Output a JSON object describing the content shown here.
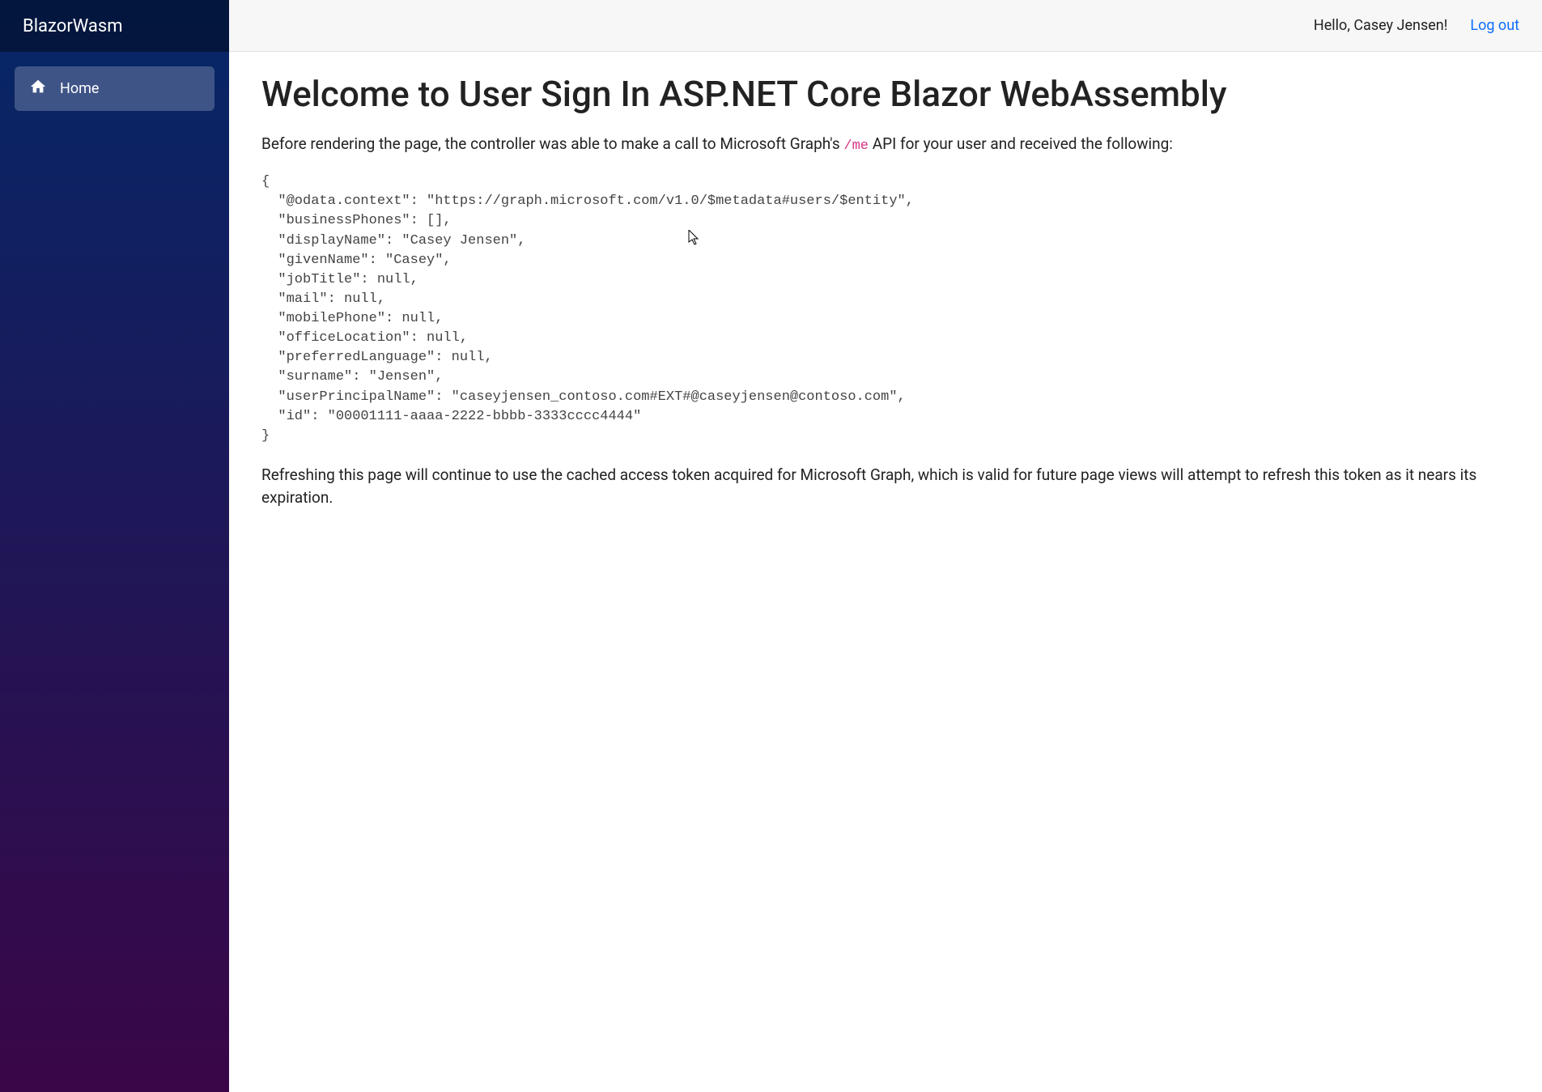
{
  "sidebar": {
    "brand": "BlazorWasm",
    "items": [
      {
        "label": "Home",
        "icon": "home-icon",
        "active": true
      }
    ]
  },
  "topbar": {
    "greeting": "Hello, Casey Jensen!",
    "logout_label": "Log out"
  },
  "main": {
    "title": "Welcome to User Sign In ASP.NET Core Blazor WebAssembly",
    "intro_prefix": "Before rendering the page, the controller was able to make a call to Microsoft Graph's ",
    "intro_code": "/me",
    "intro_suffix": " API for your user and received the following:",
    "json_text": "{\n  \"@odata.context\": \"https://graph.microsoft.com/v1.0/$metadata#users/$entity\",\n  \"businessPhones\": [],\n  \"displayName\": \"Casey Jensen\",\n  \"givenName\": \"Casey\",\n  \"jobTitle\": null,\n  \"mail\": null,\n  \"mobilePhone\": null,\n  \"officeLocation\": null,\n  \"preferredLanguage\": null,\n  \"surname\": \"Jensen\",\n  \"userPrincipalName\": \"caseyjensen_contoso.com#EXT#@caseyjensen@contoso.com\",\n  \"id\": \"00001111-aaaa-2222-bbbb-3333cccc4444\"\n}",
    "footer_note": "Refreshing this page will continue to use the cached access token acquired for Microsoft Graph, which is valid for future page views will attempt to refresh this token as it nears its expiration."
  }
}
